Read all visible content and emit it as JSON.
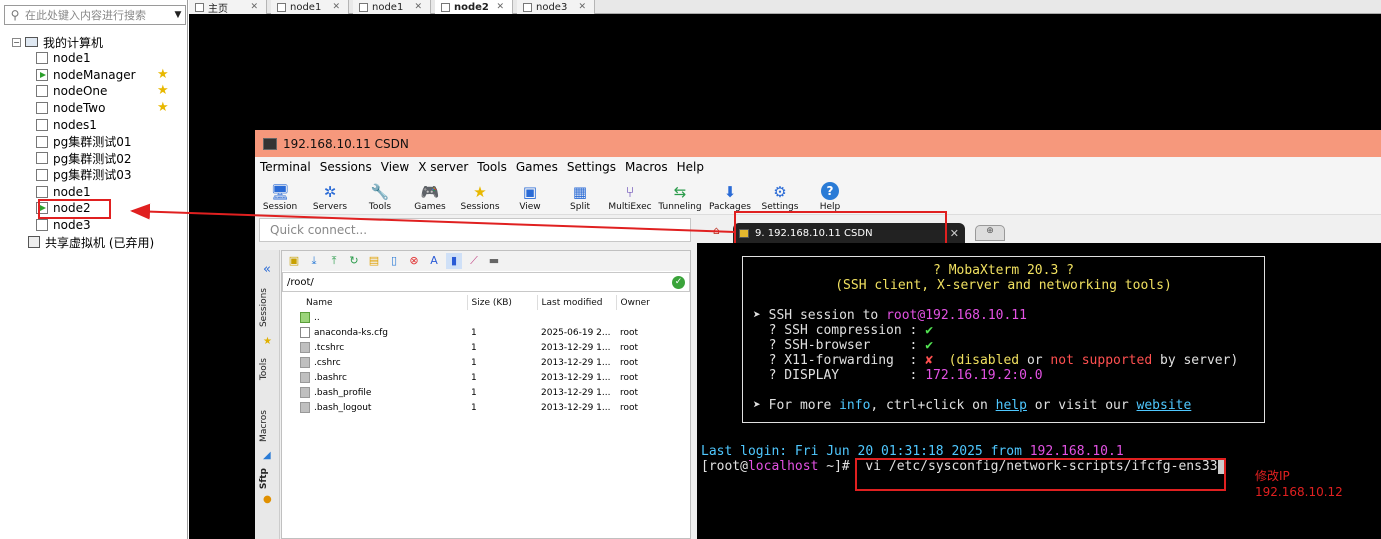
{
  "left_panel": {
    "search_placeholder": "在此处键入内容进行搜索",
    "root_label": "我的计算机",
    "items": [
      {
        "label": "node1",
        "starred": false,
        "running": false
      },
      {
        "label": "nodeManager",
        "starred": true,
        "running": true
      },
      {
        "label": "nodeOne",
        "starred": true,
        "running": false
      },
      {
        "label": "nodeTwo",
        "starred": true,
        "running": false
      },
      {
        "label": "nodes1",
        "starred": false,
        "running": false
      },
      {
        "label": "pg集群测试01",
        "starred": false,
        "running": false
      },
      {
        "label": "pg集群测试02",
        "starred": false,
        "running": false
      },
      {
        "label": "pg集群测试03",
        "starred": false,
        "running": false
      },
      {
        "label": "node1",
        "starred": false,
        "running": false
      },
      {
        "label": "node2",
        "starred": false,
        "running": true
      },
      {
        "label": "node3",
        "starred": false,
        "running": false
      }
    ],
    "shared_label": "共享虚拟机 (已弃用)"
  },
  "vm_tabs": [
    {
      "label": "主页",
      "active": false
    },
    {
      "label": "node1",
      "active": false
    },
    {
      "label": "node1",
      "active": false
    },
    {
      "label": "node2",
      "active": true
    },
    {
      "label": "node3",
      "active": false
    }
  ],
  "moba": {
    "title": "192.168.10.11 CSDN",
    "menu": [
      "Terminal",
      "Sessions",
      "View",
      "X server",
      "Tools",
      "Games",
      "Settings",
      "Macros",
      "Help"
    ],
    "toolbar": [
      {
        "label": "Session",
        "icon": "session-icon"
      },
      {
        "label": "Servers",
        "icon": "servers-icon"
      },
      {
        "label": "Tools",
        "icon": "tools-icon"
      },
      {
        "label": "Games",
        "icon": "games-icon"
      },
      {
        "label": "Sessions",
        "icon": "star-icon"
      },
      {
        "label": "View",
        "icon": "view-icon"
      },
      {
        "label": "Split",
        "icon": "split-icon"
      },
      {
        "label": "MultiExec",
        "icon": "multiexec-icon"
      },
      {
        "label": "Tunneling",
        "icon": "tunneling-icon"
      },
      {
        "label": "Packages",
        "icon": "packages-icon"
      },
      {
        "label": "Settings",
        "icon": "settings-icon"
      },
      {
        "label": "Help",
        "icon": "help-icon"
      }
    ],
    "quick_connect_placeholder": "Quick connect...",
    "side_tabs": [
      "Sessions",
      "Tools",
      "Macros",
      "Sftp"
    ],
    "sftp": {
      "path": "/root/",
      "columns": [
        "Name",
        "Size (KB)",
        "Last modified",
        "Owner"
      ],
      "files": [
        {
          "name": "..",
          "size": "",
          "modified": "",
          "owner": "",
          "type": "up"
        },
        {
          "name": "anaconda-ks.cfg",
          "size": "1",
          "modified": "2025-06-19 2...",
          "owner": "root",
          "type": "doc"
        },
        {
          "name": ".tcshrc",
          "size": "1",
          "modified": "2013-12-29 1...",
          "owner": "root",
          "type": "file"
        },
        {
          "name": ".cshrc",
          "size": "1",
          "modified": "2013-12-29 1...",
          "owner": "root",
          "type": "file"
        },
        {
          "name": ".bashrc",
          "size": "1",
          "modified": "2013-12-29 1...",
          "owner": "root",
          "type": "file"
        },
        {
          "name": ".bash_profile",
          "size": "1",
          "modified": "2013-12-29 1...",
          "owner": "root",
          "type": "file"
        },
        {
          "name": ".bash_logout",
          "size": "1",
          "modified": "2013-12-29 1...",
          "owner": "root",
          "type": "file"
        }
      ]
    },
    "session_tab": "9. 192.168.10.11 CSDN",
    "terminal": {
      "banner_title": "? MobaXterm 20.3 ?",
      "banner_sub": "(SSH client, X-server and networking tools)",
      "ssh_prefix": "➤ SSH session to ",
      "ssh_user": "root",
      "ssh_host": "@192.168.10.11",
      "compression_label": "  ? SSH compression : ",
      "compression_val": "✔",
      "browser_label": "  ? SSH-browser     : ",
      "browser_val": "✔",
      "x11_label": "  ? X11-forwarding  : ",
      "x11_val": "✘",
      "x11_note_a": "  (disabled ",
      "x11_note_or": "or",
      "x11_note_not": " not supported",
      "x11_note_by": " by server)",
      "display_label": "  ? DISPLAY         : ",
      "display_val": "172.16.19.2:0.0",
      "more_a": "➤ For more ",
      "more_info": "info",
      "more_b": ", ctrl+click on ",
      "more_help": "help",
      "more_c": " or visit our ",
      "more_web": "website",
      "last_login_a": "Last login: Fri Jun 20 01:31:18 2025 from ",
      "last_login_ip": "192.168.10.1",
      "prompt_a": "[root@",
      "prompt_host": "localhost",
      "prompt_b": " ~]# ",
      "command": " vi /etc/sysconfig/network-scripts/ifcfg-ens33"
    }
  },
  "annotation": {
    "line1": "修改IP",
    "line2": "192.168.10.12"
  },
  "colors": {
    "title_bar": "#f6987c",
    "annotation_red": "#e02020",
    "terminal_bg": "#000000"
  }
}
